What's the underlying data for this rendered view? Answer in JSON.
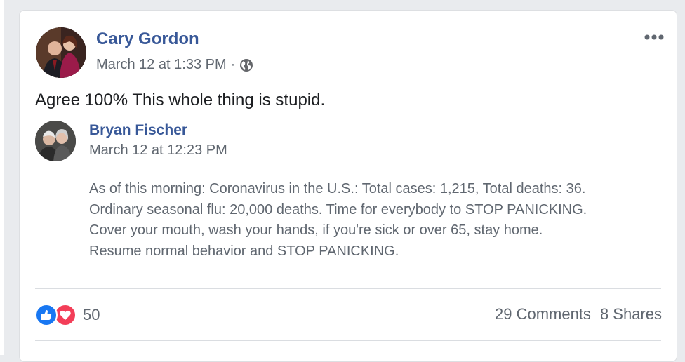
{
  "post": {
    "author": "Cary Gordon",
    "timestamp": "March 12 at 1:33 PM",
    "separator": "·",
    "privacy_icon": "globe-icon",
    "more_icon": "more-options-icon",
    "text": "Agree 100% This whole thing is stupid."
  },
  "shared": {
    "author": "Bryan Fischer",
    "timestamp": "March 12 at 12:23 PM",
    "lines": [
      "As of this morning: Coronavirus in the U.S.: Total cases: 1,215, Total deaths: 36.",
      "Ordinary seasonal flu: 20,000 deaths. Time for everybody to STOP PANICKING.",
      "Cover your mouth, wash your hands, if you're sick or over 65, stay home.",
      "Resume normal behavior and STOP PANICKING."
    ]
  },
  "footer": {
    "reaction_icons": [
      "like-icon",
      "love-icon"
    ],
    "reaction_count": "50",
    "comments": "29 Comments",
    "shares": "8 Shares"
  },
  "colors": {
    "link": "#385898",
    "secondary": "#606770",
    "like": "#1877f2",
    "love": "#f33e58"
  }
}
